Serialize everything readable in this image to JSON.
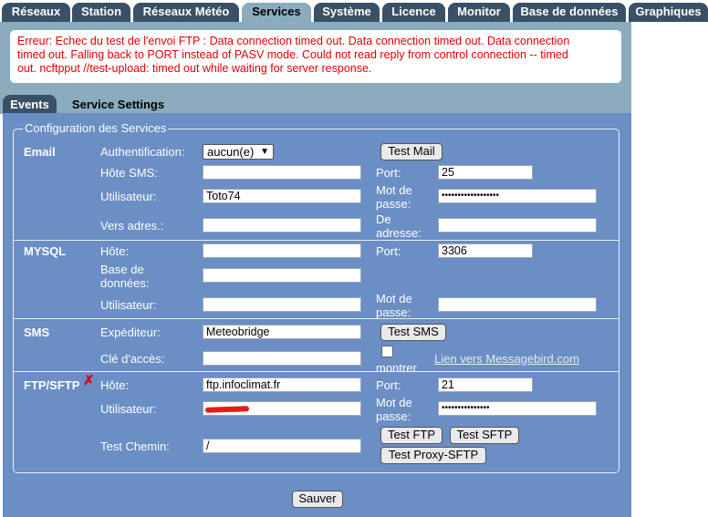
{
  "nav": {
    "tabs": [
      "Réseaux",
      "Station",
      "Réseaux Météo",
      "Services",
      "Système",
      "Licence",
      "Monitor",
      "Base de données",
      "Graphiques"
    ],
    "active": "Services"
  },
  "error": {
    "line1": "Erreur: Echec du test de l'envoi FTP : Data connection timed out. Data connection timed out. Data connection",
    "line2": "timed out. Falling back to PORT instead of PASV mode. Could not read reply from control connection -- timed",
    "line3": "out. ncftpput //test-upload: timed out while waiting for server response."
  },
  "subtabs": {
    "events": "Events",
    "settings": "Service Settings"
  },
  "legend": "Configuration des Services",
  "email": {
    "section": "Email",
    "auth_label": "Authentification:",
    "auth_value": "aucun(e)",
    "test_button": "Test Mail",
    "host_label": "Hôte SMS:",
    "host_value": "",
    "port_label": "Port:",
    "port_value": "25",
    "user_label": "Utilisateur:",
    "user_value": "Toto74",
    "pass_label_1": "Mot de",
    "pass_label_2": "passe:",
    "pass_value": "••••••••••••••••••",
    "to_label": "Vers adres.:",
    "to_value": "",
    "from_label_1": "De",
    "from_label_2": "adresse:",
    "from_value": ""
  },
  "mysql": {
    "section": "MYSQL",
    "host_label": "Hôte:",
    "host_value": "",
    "port_label": "Port:",
    "port_value": "3306",
    "db_label_1": "Base de",
    "db_label_2": "données:",
    "db_value": "",
    "user_label": "Utilisateur:",
    "user_value": "",
    "pass_label_1": "Mot de",
    "pass_label_2": "passe:",
    "pass_value": ""
  },
  "sms": {
    "section": "SMS",
    "sender_label": "Expéditeur:",
    "sender_value": "Meteobridge",
    "test_button": "Test SMS",
    "key_label": "Clé d'accès:",
    "key_value": "",
    "show_label": "montrer",
    "link": "Lien vers Messagebird.com"
  },
  "ftp": {
    "section": "FTP/SFTP",
    "error_mark": "✗",
    "host_label": "Hôte:",
    "host_value": "ftp.infoclimat.fr",
    "port_label": "Port:",
    "port_value": "21",
    "user_label": "Utilisateur:",
    "user_value": "",
    "pass_label_1": "Mot de",
    "pass_label_2": "passe:",
    "pass_value": "•••••••••••••••",
    "path_label": "Test Chemin:",
    "path_value": "/",
    "test_ftp": "Test FTP",
    "test_sftp": "Test SFTP",
    "test_proxy": "Test Proxy-SFTP"
  },
  "save": "Sauver",
  "colors": {
    "nav": "#3a5066",
    "panel": "#8aacbe",
    "main": "#6b8ec4",
    "error": "#e00000"
  }
}
